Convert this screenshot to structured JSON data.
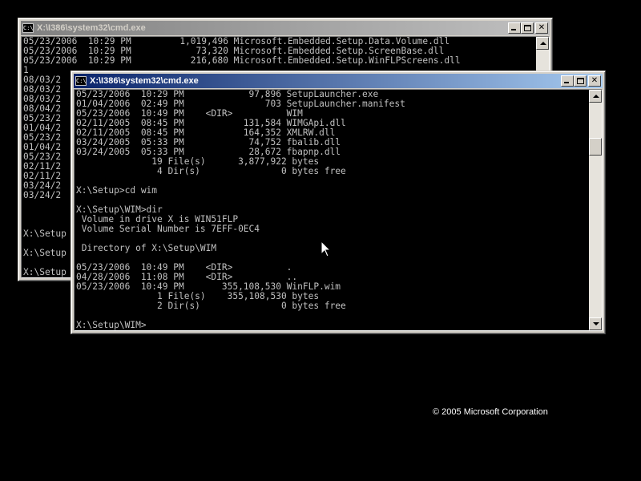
{
  "back_window": {
    "title": "X:\\I386\\system32\\cmd.exe",
    "icon_label": "C:\\",
    "console_text": "05/23/2006  10:29 PM         1,019,496 Microsoft.Embedded.Setup.Data.Volume.dll\n05/23/2006  10:29 PM            73,320 Microsoft.Embedded.Setup.ScreenBase.dll\n05/23/2006  10:29 PM           216,680 Microsoft.Embedded.Setup.WinFLPScreens.dll\n1\n08/03/2\n08/03/2\n08/03/2\n08/04/2\n05/23/2\n01/04/2\n05/23/2\n01/04/2\n05/23/2\n02/11/2\n02/11/2\n03/24/2\n03/24/2\n\n\n\nX:\\Setup\n\nX:\\Setup\n\nX:\\Setup"
  },
  "front_window": {
    "title": "X:\\I386\\system32\\cmd.exe",
    "icon_label": "C:\\",
    "console_text": "05/23/2006  10:29 PM            97,896 SetupLauncher.exe\n01/04/2006  02:49 PM               703 SetupLauncher.manifest\n05/23/2006  10:49 PM    <DIR>          WIM\n02/11/2005  08:45 PM           131,584 WIMGApi.dll\n02/11/2005  08:45 PM           164,352 XMLRW.dll\n03/24/2005  05:33 PM            74,752 fbalib.dll\n03/24/2005  05:33 PM            28,672 fbapnp.dll\n              19 File(s)      3,877,922 bytes\n               4 Dir(s)               0 bytes free\n\nX:\\Setup>cd wim\n\nX:\\Setup\\WIM>dir\n Volume in drive X is WIN51FLP\n Volume Serial Number is 7EFF-0EC4\n\n Directory of X:\\Setup\\WIM\n\n05/23/2006  10:49 PM    <DIR>          .\n04/28/2006  11:08 PM    <DIR>          ..\n05/23/2006  10:49 PM       355,108,530 WinFLP.wim\n               1 File(s)    355,108,530 bytes\n               2 Dir(s)               0 bytes free\n\nX:\\Setup\\WIM>"
  },
  "footer": {
    "copyright": "© 2005 Microsoft Corporation"
  },
  "colors": {
    "desktop": "#000000",
    "active_title_start": "#0a246a",
    "active_title_end": "#a6caf0",
    "inactive_title_start": "#808080",
    "inactive_title_end": "#c0c0c0",
    "console_bg": "#000000",
    "console_text": "#c0c0c0",
    "window_face": "#d4d0c8"
  },
  "icons": {
    "window_icon": "cmd-icon",
    "minimize": "minimize-icon",
    "maximize": "maximize-icon",
    "close": "close-icon",
    "scroll_up": "scroll-up-icon",
    "scroll_down": "scroll-down-icon",
    "pointer": "mouse-pointer-icon"
  }
}
